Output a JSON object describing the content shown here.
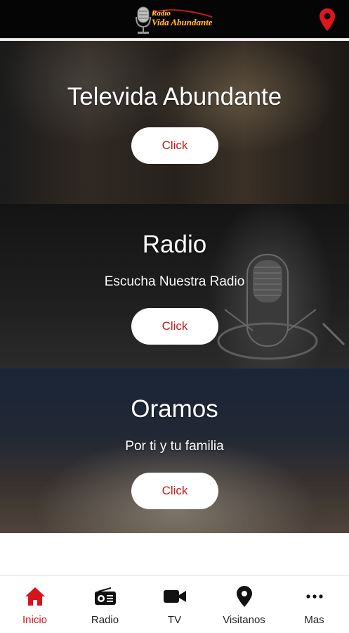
{
  "header": {
    "logo_line1": "Radio",
    "logo_line2": "Vida Abundante",
    "location_icon": "map-pin-icon"
  },
  "sections": [
    {
      "title": "Televida Abundante",
      "subtitle": "",
      "button": "Click"
    },
    {
      "title": "Radio",
      "subtitle": "Escucha Nuestra Radio",
      "button": "Click"
    },
    {
      "title": "Oramos",
      "subtitle": "Por ti y tu familia",
      "button": "Click"
    }
  ],
  "nav": {
    "items": [
      {
        "label": "Inicio",
        "icon": "home-icon",
        "active": true
      },
      {
        "label": "Radio",
        "icon": "radio-icon",
        "active": false
      },
      {
        "label": "TV",
        "icon": "video-camera-icon",
        "active": false
      },
      {
        "label": "Visitanos",
        "icon": "location-pin-icon",
        "active": false
      },
      {
        "label": "Mas",
        "icon": "more-dots-icon",
        "active": false
      }
    ]
  },
  "colors": {
    "accent": "#d7131c",
    "button_text": "#c0191c",
    "header_bg": "#050505",
    "logo_gold": "#f2c21a"
  }
}
